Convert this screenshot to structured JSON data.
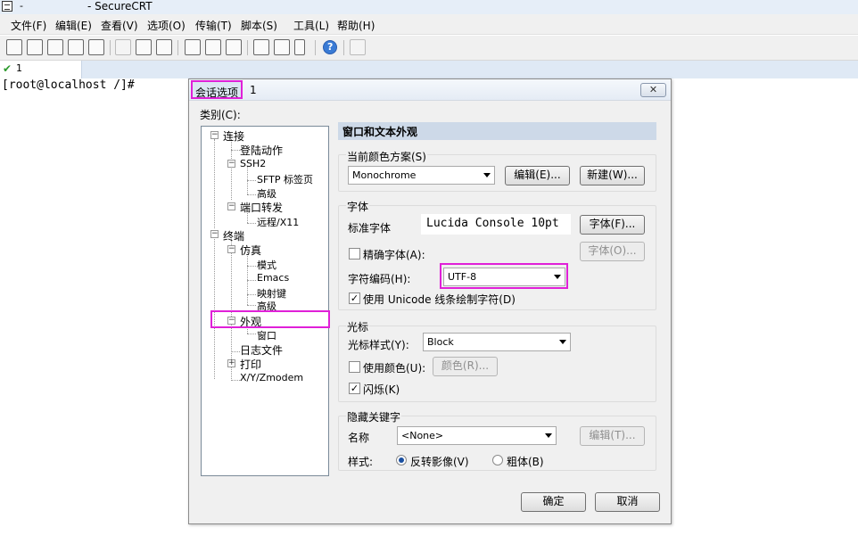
{
  "window": {
    "title": "- SecureCRT",
    "title_prefix": "-"
  },
  "menu": [
    "文件(F)",
    "编辑(E)",
    "查看(V)",
    "选项(O)",
    "传输(T)",
    "脚本(S)",
    "工具(L)",
    "帮助(H)"
  ],
  "toolbar": {
    "buttons": [
      "connect-icon",
      "quick-connect-icon",
      "connect-tab-icon",
      "reconnect-icon",
      "disconnect-icon",
      "copy-icon",
      "paste-icon",
      "find-icon",
      "print-setup-icon",
      "print-preview-icon",
      "print-icon",
      "session-options-icon",
      "global-options-icon",
      "keymap-icon",
      "help-icon",
      "log-icon"
    ]
  },
  "tab": {
    "label": "1"
  },
  "terminal": {
    "prompt": "[root@localhost /]#"
  },
  "dialog": {
    "title": "会话选项",
    "title_suffix": "1",
    "close": "✕",
    "category_label": "类别(C):",
    "tree": [
      "连接",
      "登陆动作",
      "SSH2",
      "SFTP 标签页",
      "高级",
      "端口转发",
      "远程/X11",
      "终端",
      "仿真",
      "模式",
      "Emacs",
      "映射键",
      "高级",
      "外观",
      "窗口",
      "日志文件",
      "打印",
      "X/Y/Zmodem"
    ],
    "panel_title": "窗口和文本外观",
    "color_scheme": {
      "group": "当前颜色方案(S)",
      "value": "Monochrome",
      "edit": "编辑(E)...",
      "new": "新建(W)..."
    },
    "font": {
      "group": "字体",
      "standard_label": "标准字体",
      "standard_value": "Lucida Console 10pt",
      "font_button": "字体(F)...",
      "precise_label": "精确字体(A):",
      "precise_button": "字体(O)...",
      "encoding_label": "字符编码(H):",
      "encoding_value": "UTF-8",
      "unicode_label": "使用 Unicode 线条绘制字符(D)"
    },
    "cursor": {
      "group": "光标",
      "style_label": "光标样式(Y):",
      "style_value": "Block",
      "use_color_label": "使用颜色(U):",
      "color_button": "颜色(R)...",
      "blink_label": "闪烁(K)"
    },
    "hotkey": {
      "group": "隐藏关键字",
      "name_label": "名称",
      "name_value": "<None>",
      "edit_button": "编辑(T)...",
      "style_label": "样式:",
      "reverse_label": "反转影像(V)",
      "bold_label": "粗体(B)"
    },
    "ok": "确定",
    "cancel": "取消"
  }
}
